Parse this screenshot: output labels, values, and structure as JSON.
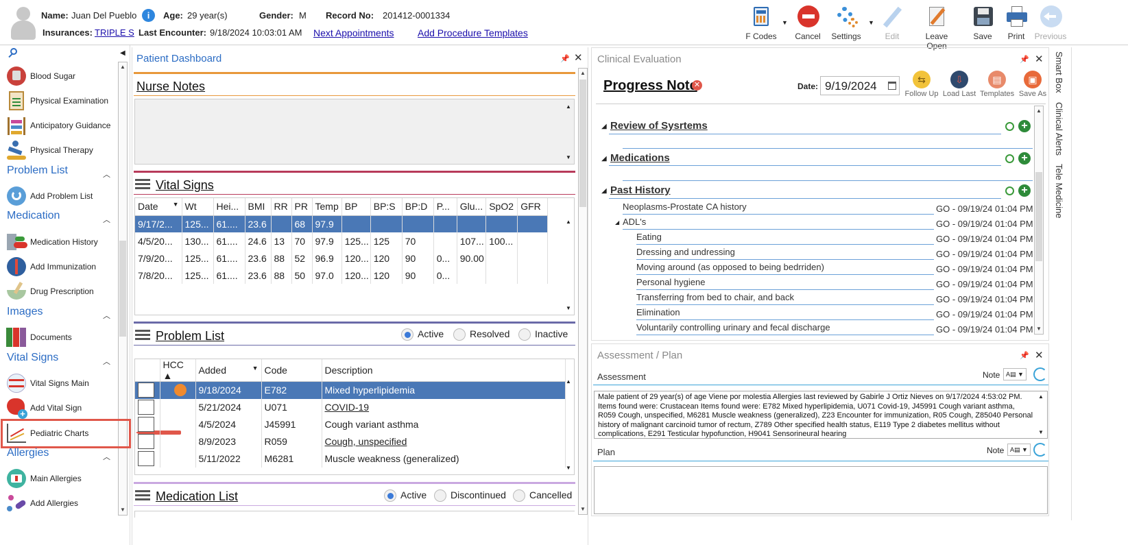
{
  "header": {
    "name_label": "Name:",
    "name": "Juan Del Pueblo",
    "age_label": "Age:",
    "age": "29 year(s)",
    "gender_label": "Gender:",
    "gender": "M",
    "record_label": "Record No:",
    "record": "201412-0001334",
    "insurances_label": "Insurances:",
    "insurance": "TRIPLE S",
    "last_encounter_label": "Last Encounter:",
    "last_encounter": "9/18/2024 10:03:01 AM",
    "next_appointments": "Next Appointments",
    "add_procedure_templates": "Add Procedure Templates"
  },
  "toolbar": {
    "fcodes": "F Codes",
    "cancel": "Cancel",
    "settings": "Settings",
    "edit": "Edit",
    "leave_open": "Leave Open",
    "save": "Save",
    "print": "Print",
    "previous": "Previous"
  },
  "sidebar": {
    "items_top": [
      "Blood Sugar",
      "Physical Examination",
      "Anticipatory Guidance",
      "Physical Therapy"
    ],
    "problem_list_head": "Problem List",
    "add_problem_list": "Add Problem List",
    "medication_head": "Medication",
    "medication_history": "Medication History",
    "add_immunization": "Add Immunization",
    "drug_prescription": "Drug Prescription",
    "images_head": "Images",
    "documents": "Documents",
    "vital_signs_head": "Vital Signs",
    "vital_signs_main": "Vital Signs Main",
    "add_vital_sign": "Add Vital Sign",
    "pediatric_charts": "Pediatric Charts",
    "allergies_head": "Allergies",
    "main_allergies": "Main Allergies",
    "add_allergies": "Add Allergies"
  },
  "dashboard": {
    "title": "Patient Dashboard",
    "nurse_notes": "Nurse Notes",
    "vital_signs": "Vital Signs",
    "vital_columns": [
      "Date",
      "Wt",
      "Hei...",
      "BMI",
      "RR",
      "PR",
      "Temp",
      "BP",
      "BP:S",
      "BP:D",
      "P...",
      "Glu...",
      "SpO2",
      "GFR"
    ],
    "vital_rows": [
      [
        "9/17/2...",
        "125...",
        "61....",
        "23.6",
        "",
        "68",
        "97.9",
        "",
        "",
        "",
        "",
        "",
        "",
        ""
      ],
      [
        "4/5/20...",
        "130...",
        "61....",
        "24.6",
        "13",
        "70",
        "97.9",
        "125...",
        "125",
        "70",
        "",
        "107...",
        "100...",
        ""
      ],
      [
        "7/9/20...",
        "125...",
        "61....",
        "23.6",
        "88",
        "52",
        "96.9",
        "120...",
        "120",
        "90",
        "0...",
        "90.00",
        "",
        ""
      ],
      [
        "7/8/20...",
        "125...",
        "61....",
        "23.6",
        "88",
        "50",
        "97.0",
        "120...",
        "120",
        "90",
        "0...",
        "",
        "",
        ""
      ]
    ],
    "problem_list": "Problem List",
    "problem_filters": [
      "Active",
      "Resolved",
      "Inactive"
    ],
    "problem_columns": [
      "",
      "HCC",
      "Added",
      "Code",
      "Description"
    ],
    "problem_rows": [
      {
        "added": "9/18/2024",
        "code": "E782",
        "desc": "Mixed hyperlipidemia"
      },
      {
        "added": "5/21/2024",
        "code": "U071",
        "desc": "COVID-19"
      },
      {
        "added": "4/5/2024",
        "code": "J45991",
        "desc": "Cough variant asthma"
      },
      {
        "added": "8/9/2023",
        "code": "R059",
        "desc": "Cough, unspecified"
      },
      {
        "added": "5/11/2022",
        "code": "M6281",
        "desc": "Muscle weakness (generalized)"
      }
    ],
    "medication_list": "Medication List",
    "medication_filters": [
      "Active",
      "Discontinued",
      "Cancelled"
    ]
  },
  "clinical": {
    "title": "Clinical Evaluation",
    "progress_note": "Progress Note",
    "date_label": "Date:",
    "date": "9/19/2024",
    "actions": [
      "Follow Up",
      "Load Last",
      "Templates",
      "Save As"
    ],
    "sections": [
      "Review of Sysrtems",
      "Medications",
      "Past History"
    ],
    "history_items": [
      "Neoplasms-Prostate CA history",
      "ADL's",
      "Eating",
      "Dressing and undressing",
      "Moving around (as opposed to being bedrriden)",
      "Personal hygiene",
      "Transferring from bed to chair, and back",
      "Elimination",
      "Voluntarily controlling urinary and fecal discharge"
    ],
    "stamp": "GO - 09/19/24 01:04 PM"
  },
  "assessment": {
    "title": "Assessment / Plan",
    "assessment_label": "Assessment",
    "note_label": "Note",
    "text": "Male patient of 29 year(s) of age Viene por molestia     Allergies last reviewed by Gabirle J Ortiz Nieves on 9/17/2024 4:53:02 PM.    Items found were:  Crustacean  Items found were:  E782 Mixed hyperlipidemia, U071 Covid-19, J45991 Cough variant asthma, R059 Cough, unspecified, M6281 Muscle weakness (generalized), Z23 Encounter for immunization, R05 Cough, Z85040 Personal history of malignant carcinoid tumor of rectum, Z789 Other specified health status, E119 Type 2 diabetes mellitus without complications, E291 Testicular hypofunction, H9041 Sensorineural hearing",
    "plan_label": "Plan"
  },
  "right_tabs": [
    "Smart Box",
    "Clinical Alerts",
    "Tele Medicine"
  ]
}
